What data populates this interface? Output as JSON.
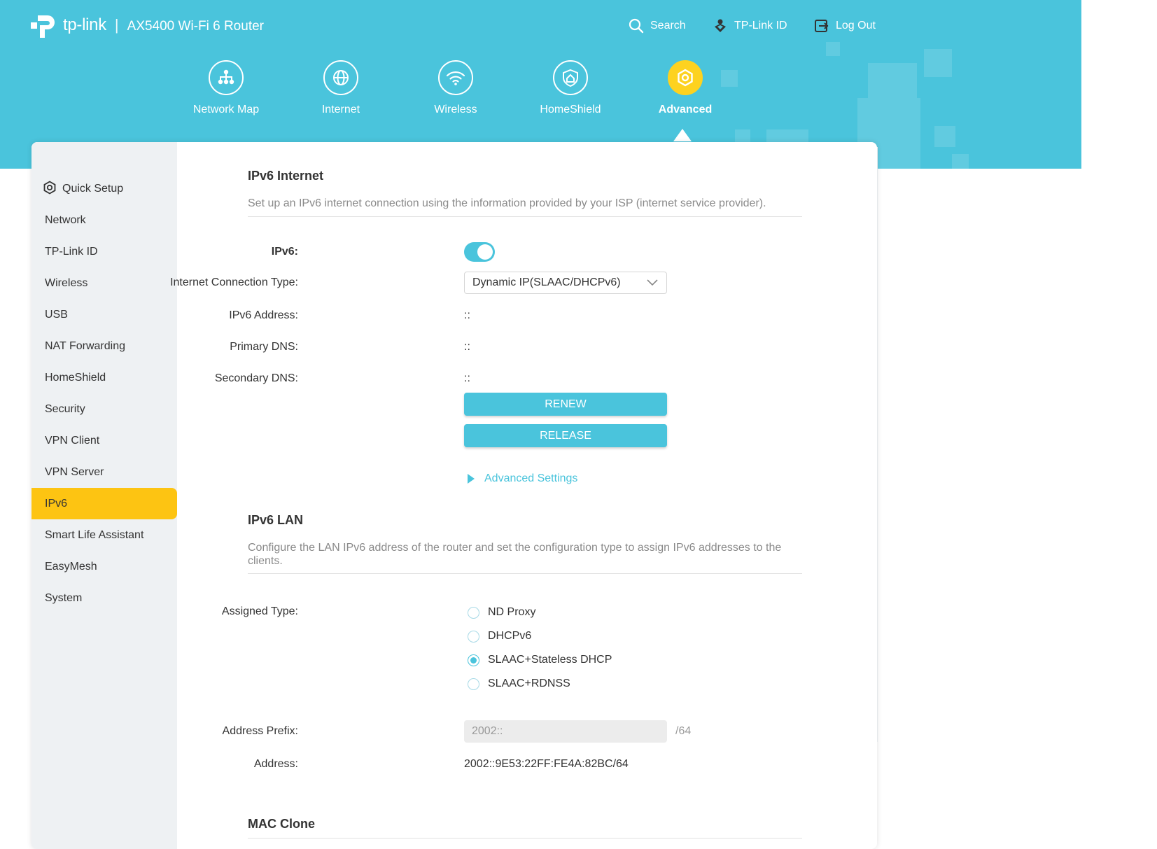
{
  "header": {
    "brand": "tp-link",
    "separator": "|",
    "model": "AX5400 Wi-Fi 6 Router",
    "links": [
      {
        "label": "Search",
        "icon": "search-icon"
      },
      {
        "label": "TP-Link ID",
        "icon": "tplink-id-icon"
      },
      {
        "label": "Log Out",
        "icon": "logout-icon"
      }
    ],
    "nav": [
      {
        "label": "Network Map",
        "icon": "network-map-icon"
      },
      {
        "label": "Internet",
        "icon": "globe-icon"
      },
      {
        "label": "Wireless",
        "icon": "wifi-icon"
      },
      {
        "label": "HomeShield",
        "icon": "homeshield-icon"
      },
      {
        "label": "Advanced",
        "icon": "gear-icon",
        "active": true
      }
    ]
  },
  "colors": {
    "accent": "#4ac4dc",
    "active_nav": "#fdd21f",
    "active_sidebar": "#fdc412"
  },
  "sidebar": {
    "items": [
      {
        "label": "Quick Setup",
        "icon": "gear-icon"
      },
      {
        "label": "Network"
      },
      {
        "label": "TP-Link ID"
      },
      {
        "label": "Wireless"
      },
      {
        "label": "USB"
      },
      {
        "label": "NAT Forwarding"
      },
      {
        "label": "HomeShield"
      },
      {
        "label": "Security"
      },
      {
        "label": "VPN Client"
      },
      {
        "label": "VPN Server"
      },
      {
        "label": "IPv6",
        "active": true
      },
      {
        "label": "Smart Life Assistant"
      },
      {
        "label": "EasyMesh"
      },
      {
        "label": "System"
      }
    ]
  },
  "ipv6_internet": {
    "title": "IPv6 Internet",
    "description": "Set up an IPv6 internet connection using the information provided by your ISP (internet service provider).",
    "ipv6_label": "IPv6:",
    "ipv6_enabled": true,
    "connection_type_label": "Internet Connection Type:",
    "connection_type_value": "Dynamic IP(SLAAC/DHCPv6)",
    "address_label": "IPv6 Address:",
    "address_value": "::",
    "primary_dns_label": "Primary DNS:",
    "primary_dns_value": "::",
    "secondary_dns_label": "Secondary DNS:",
    "secondary_dns_value": "::",
    "renew_label": "RENEW",
    "release_label": "RELEASE",
    "advanced_settings_label": "Advanced Settings"
  },
  "ipv6_lan": {
    "title": "IPv6 LAN",
    "description": "Configure the LAN IPv6 address of the router and set the configuration type to assign IPv6 addresses to the clients.",
    "assigned_type_label": "Assigned Type:",
    "assigned_types": [
      {
        "label": "ND Proxy",
        "selected": false
      },
      {
        "label": "DHCPv6",
        "selected": false
      },
      {
        "label": "SLAAC+Stateless DHCP",
        "selected": true
      },
      {
        "label": "SLAAC+RDNSS",
        "selected": false
      }
    ],
    "prefix_label": "Address Prefix:",
    "prefix_placeholder": "2002::",
    "prefix_suffix": "/64",
    "address_label": "Address:",
    "address_value": "2002::9E53:22FF:FE4A:82BC/64"
  },
  "mac_clone": {
    "title": "MAC Clone"
  }
}
